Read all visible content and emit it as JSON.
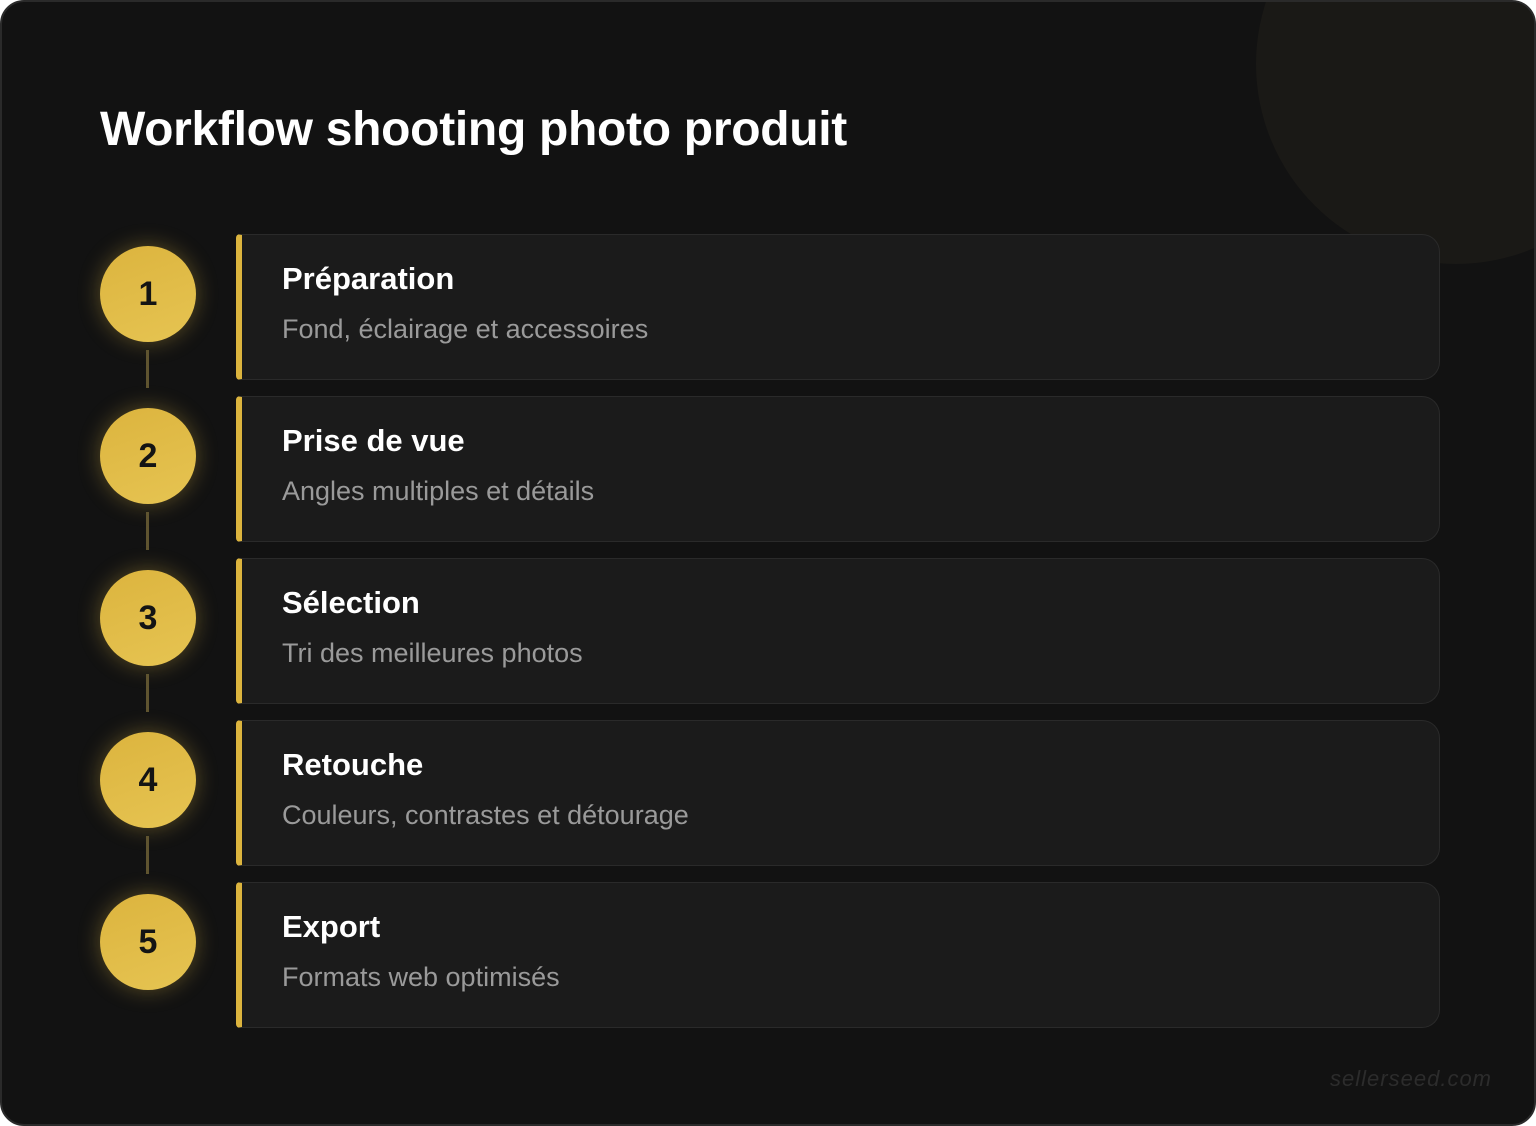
{
  "title": "Workflow shooting photo produit",
  "accent_color": "#dcb43e",
  "background_color": "#121212",
  "steps": [
    {
      "number": "1",
      "title": "Préparation",
      "description": "Fond, éclairage et accessoires"
    },
    {
      "number": "2",
      "title": "Prise de vue",
      "description": "Angles multiples et détails"
    },
    {
      "number": "3",
      "title": "Sélection",
      "description": "Tri des meilleures photos"
    },
    {
      "number": "4",
      "title": "Retouche",
      "description": "Couleurs, contrastes et détourage"
    },
    {
      "number": "5",
      "title": "Export",
      "description": "Formats web optimisés"
    }
  ],
  "watermark": "sellerseed.com"
}
